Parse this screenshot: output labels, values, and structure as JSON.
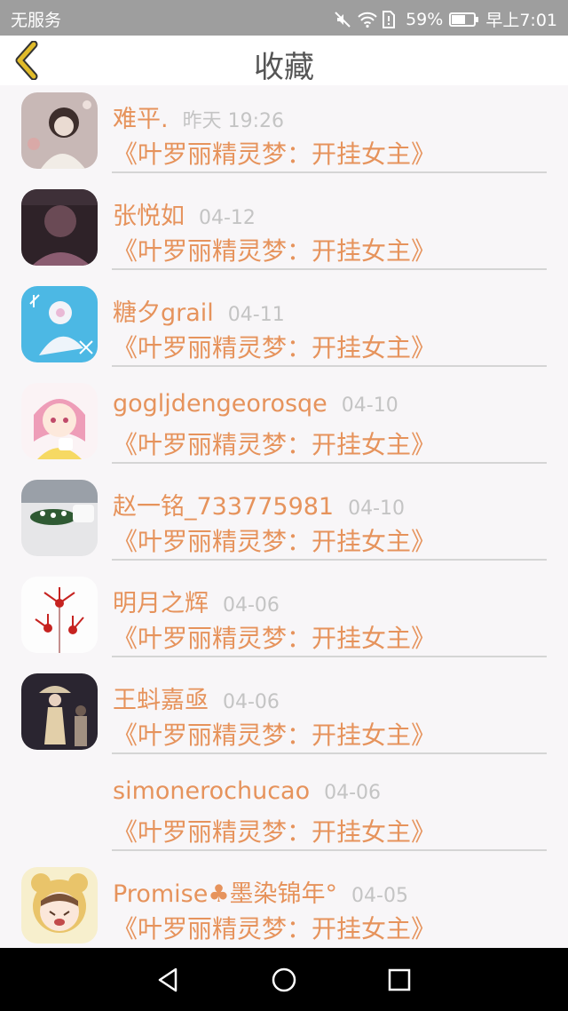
{
  "status_bar": {
    "carrier": "无服务",
    "battery": "59%",
    "time": "早上7:01",
    "icons": [
      "mute-icon",
      "wifi-icon",
      "sim-alert-icon",
      "battery-icon"
    ]
  },
  "header": {
    "title": "收藏",
    "back_icon": "chevron-left-icon"
  },
  "favorites": [
    {
      "name": "难平.",
      "date": "昨天 19:26",
      "book": "《叶罗丽精灵梦：开挂女主》"
    },
    {
      "name": "张悦如",
      "date": "04-12",
      "book": "《叶罗丽精灵梦：开挂女主》"
    },
    {
      "name": "糖夕grail",
      "date": "04-11",
      "book": "《叶罗丽精灵梦：开挂女主》"
    },
    {
      "name": "gogljdengeorosqe",
      "date": "04-10",
      "book": "《叶罗丽精灵梦：开挂女主》"
    },
    {
      "name": "赵一铭_733775981",
      "date": "04-10",
      "book": "《叶罗丽精灵梦：开挂女主》"
    },
    {
      "name": "明月之辉",
      "date": "04-06",
      "book": "《叶罗丽精灵梦：开挂女主》"
    },
    {
      "name": "王蚪嘉亟",
      "date": "04-06",
      "book": "《叶罗丽精灵梦：开挂女主》"
    },
    {
      "name": "simonerochucao",
      "date": "04-06",
      "book": "《叶罗丽精灵梦：开挂女主》"
    },
    {
      "name": "Promise♣墨染锦年°",
      "date": "04-05",
      "book": "《叶罗丽精灵梦：开挂女主》"
    }
  ],
  "colors": {
    "accent": "#e6935c",
    "date": "#c4c4c4",
    "back_icon": "#e0bb2a",
    "status_bar": "#9e9e9e"
  },
  "nav_bar": {
    "icons": [
      "back-triangle-icon",
      "home-circle-icon",
      "recents-square-icon"
    ]
  }
}
